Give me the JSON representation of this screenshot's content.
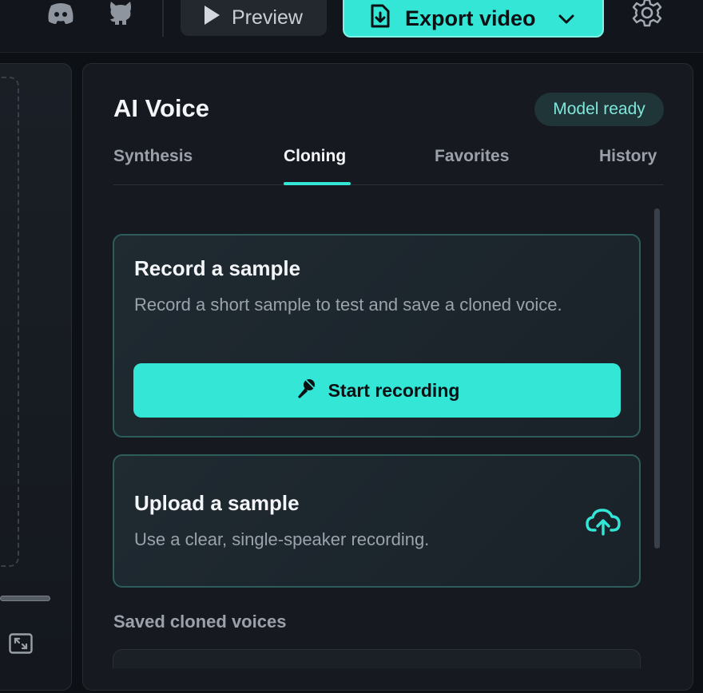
{
  "topbar": {
    "discord_icon": "discord-icon",
    "github_icon": "github-icon",
    "preview_label": "Preview",
    "export_label": "Export video",
    "settings_icon": "gear-icon"
  },
  "left_panel": {
    "fullscreen_icon": "expand-icon"
  },
  "panel": {
    "title": "AI Voice",
    "status": "Model ready",
    "tabs": [
      {
        "label": "Synthesis",
        "active": false
      },
      {
        "label": "Cloning",
        "active": true
      },
      {
        "label": "Favorites",
        "active": false
      },
      {
        "label": "History",
        "active": false
      }
    ],
    "record": {
      "title": "Record a sample",
      "description": "Record a short sample to test and save a cloned voice.",
      "button_label": "Start recording",
      "button_icon": "microphone-icon"
    },
    "upload": {
      "title": "Upload a sample",
      "description": "Use a clear, single-speaker recording.",
      "icon": "cloud-upload-icon"
    },
    "saved_heading": "Saved cloned voices"
  },
  "colors": {
    "accent": "#33e6d6",
    "background": "#0d1015",
    "panel": "#161a20",
    "badge_bg": "#1f3537",
    "badge_text": "#7fe8dc"
  }
}
